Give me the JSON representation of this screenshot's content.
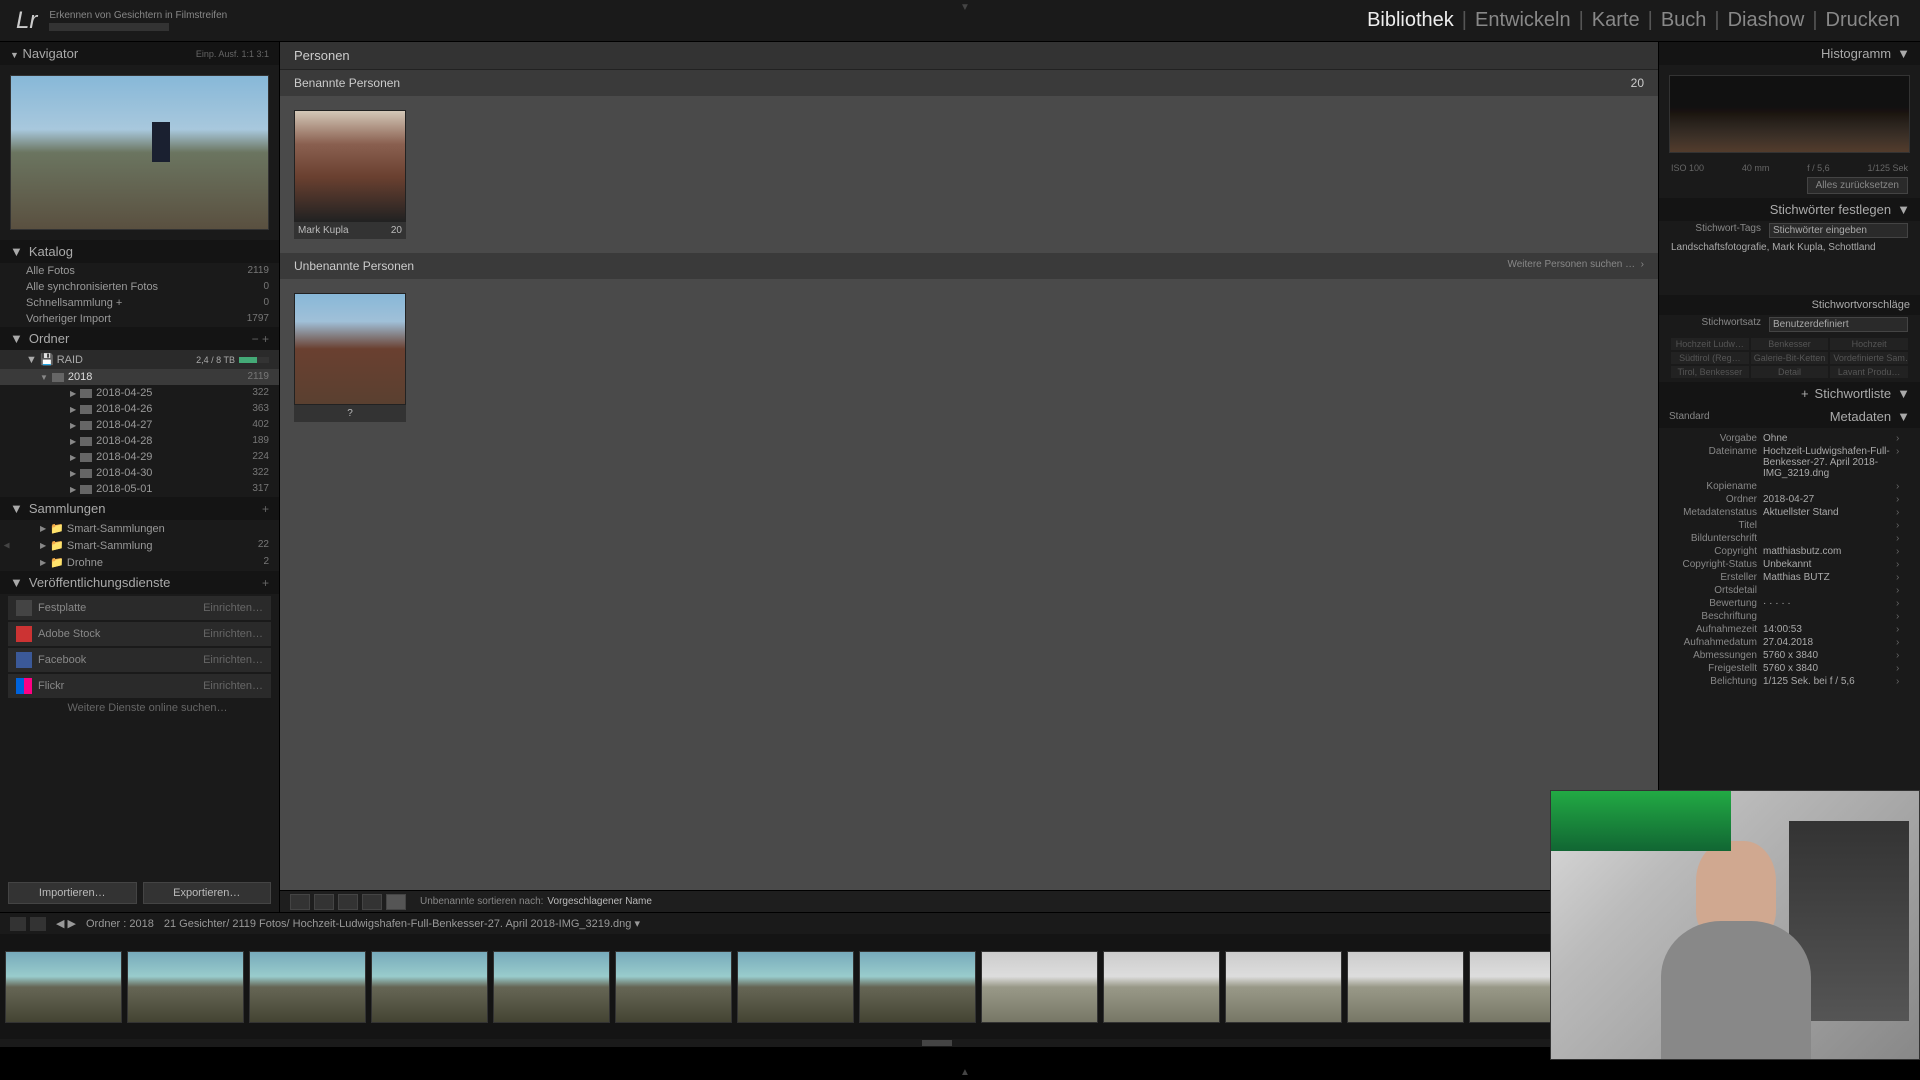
{
  "top": {
    "status": "Erkennen von Gesichtern in Filmstreifen",
    "modules": [
      "Bibliothek",
      "Entwickeln",
      "Karte",
      "Buch",
      "Diashow",
      "Drucken"
    ],
    "active_module": 0
  },
  "navigator": {
    "title": "Navigator",
    "opts": [
      "Einp.",
      "Ausf.",
      "1:1",
      "3:1"
    ]
  },
  "catalog": {
    "title": "Katalog",
    "items": [
      {
        "label": "Alle Fotos",
        "count": "2119"
      },
      {
        "label": "Alle synchronisierten Fotos",
        "count": "0"
      },
      {
        "label": "Schnellsammlung  +",
        "count": "0"
      },
      {
        "label": "Vorheriger Import",
        "count": "1797"
      }
    ]
  },
  "folders": {
    "title": "Ordner",
    "volume": {
      "name": "RAID",
      "usage": "2,4 / 8 TB"
    },
    "tree": [
      {
        "label": "2018",
        "count": "2119",
        "selected": true,
        "level": 1
      },
      {
        "label": "2018-04-25",
        "count": "322",
        "level": 2
      },
      {
        "label": "2018-04-26",
        "count": "363",
        "level": 2
      },
      {
        "label": "2018-04-27",
        "count": "402",
        "level": 2
      },
      {
        "label": "2018-04-28",
        "count": "189",
        "level": 2
      },
      {
        "label": "2018-04-29",
        "count": "224",
        "level": 2
      },
      {
        "label": "2018-04-30",
        "count": "322",
        "level": 2
      },
      {
        "label": "2018-05-01",
        "count": "317",
        "level": 2
      }
    ]
  },
  "collections": {
    "title": "Sammlungen",
    "items": [
      {
        "label": "Smart-Sammlungen",
        "count": ""
      },
      {
        "label": "Smart-Sammlung",
        "count": "22"
      },
      {
        "label": "Drohne",
        "count": "2"
      }
    ]
  },
  "publish": {
    "title": "Veröffentlichungsdienste",
    "items": [
      {
        "label": "Festplatte",
        "action": "Einrichten…",
        "cls": "hd"
      },
      {
        "label": "Adobe Stock",
        "action": "Einrichten…",
        "cls": "as"
      },
      {
        "label": "Facebook",
        "action": "Einrichten…",
        "cls": "fb"
      },
      {
        "label": "Flickr",
        "action": "Einrichten…",
        "cls": "fl"
      }
    ],
    "more": "Weitere Dienste online suchen…"
  },
  "import_btns": {
    "import": "Importieren…",
    "export": "Exportieren…"
  },
  "center": {
    "tab": "Personen",
    "named": {
      "title": "Benannte Personen",
      "count": "20",
      "people": [
        {
          "name": "Mark Kupla",
          "count": "20"
        }
      ]
    },
    "unnamed": {
      "title": "Unbenannte Personen",
      "search": "Weitere Personen suchen …",
      "people": [
        {
          "name": "?"
        }
      ]
    },
    "toolbar": {
      "sort_label": "Unbenannte sortieren nach:",
      "sort_value": "Vorgeschlagener Name"
    }
  },
  "histogram": {
    "title": "Histogramm",
    "iso": "ISO 100",
    "focal": "40 mm",
    "aperture": "f / 5,6",
    "shutter": "1/125 Sek"
  },
  "quickdev": {
    "reset": "Alles zurücksetzen"
  },
  "keywording": {
    "title": "Stichwörter festlegen",
    "tags_label": "Stichwort-Tags",
    "tags_mode": "Stichwörter eingeben",
    "tags": "Landschaftsfotografie, Mark Kupla, Schottland",
    "suggest_title": "Stichwortvorschläge",
    "set_label": "Stichwortsatz",
    "set_value": "Benutzerdefiniert",
    "suggestions": [
      "Hochzeit Ludw…",
      "Benkesser",
      "Hochzeit",
      "Südtirol (Reg…",
      "Galerie-Bit-Ketten",
      "Vordefinierte Sam…",
      "Tirol, Benkesser",
      "Detail",
      "Lavant Produ…"
    ]
  },
  "keywordlist": {
    "title": "Stichwortliste"
  },
  "metadata": {
    "title": "Metadaten",
    "preset": "Standard",
    "rows": [
      {
        "l": "Vorgabe",
        "v": "Ohne"
      },
      {
        "l": "Dateiname",
        "v": "Hochzeit-Ludwigshafen-Full-Benkesser-27. April 2018-IMG_3219.dng"
      },
      {
        "l": "Kopiename",
        "v": ""
      },
      {
        "l": "Ordner",
        "v": "2018-04-27"
      },
      {
        "l": "Metadatenstatus",
        "v": "Aktuellster Stand"
      },
      {
        "l": "Titel",
        "v": ""
      },
      {
        "l": "Bildunterschrift",
        "v": ""
      },
      {
        "l": "Copyright",
        "v": "matthiasbutz.com"
      },
      {
        "l": "Copyright-Status",
        "v": "Unbekannt"
      },
      {
        "l": "Ersteller",
        "v": "Matthias BUTZ"
      },
      {
        "l": "Ortsdetail",
        "v": ""
      },
      {
        "l": "Bewertung",
        "v": "·  ·  ·  ·  ·"
      },
      {
        "l": "Beschriftung",
        "v": ""
      },
      {
        "l": "Aufnahmezeit",
        "v": "14:00:53"
      },
      {
        "l": "Aufnahmedatum",
        "v": "27.04.2018"
      },
      {
        "l": "Abmessungen",
        "v": "5760 x 3840"
      },
      {
        "l": "Freigestellt",
        "v": "5760 x 3840"
      },
      {
        "l": "Belichtung",
        "v": "1/125 Sek. bei f / 5,6"
      }
    ]
  },
  "status": {
    "path": "Ordner : 2018",
    "info": "21 Gesichter/ 2119 Fotos/ Hochzeit-Ludwigshafen-Full-Benkesser-27. April 2018-IMG_3219.dng ▾"
  },
  "filmstrip_count": 16
}
